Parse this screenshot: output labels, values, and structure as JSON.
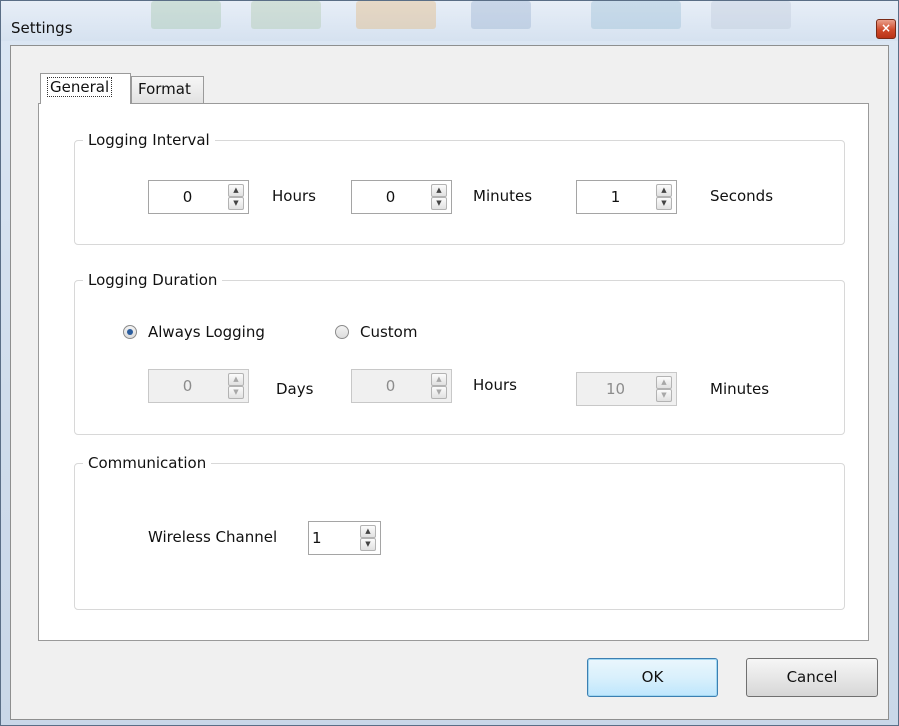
{
  "window": {
    "title": "Settings",
    "close_glyph": "×"
  },
  "tabs": [
    {
      "label": "General",
      "active": true
    },
    {
      "label": "Format",
      "active": false
    }
  ],
  "logging_interval": {
    "title": "Logging Interval",
    "hours": {
      "value": "0",
      "unit": "Hours"
    },
    "minutes": {
      "value": "0",
      "unit": "Minutes"
    },
    "seconds": {
      "value": "1",
      "unit": "Seconds"
    }
  },
  "logging_duration": {
    "title": "Logging Duration",
    "always_label": "Always Logging",
    "custom_label": "Custom",
    "selected": "always",
    "days": {
      "value": "0",
      "unit": "Days"
    },
    "hours": {
      "value": "0",
      "unit": "Hours"
    },
    "minutes": {
      "value": "10",
      "unit": "Minutes"
    }
  },
  "communication": {
    "title": "Communication",
    "channel_label": "Wireless Channel",
    "channel_value": "1"
  },
  "buttons": {
    "ok": "OK",
    "cancel": "Cancel"
  },
  "icons": {
    "up": "▲",
    "down": "▼"
  },
  "colors": {
    "accent": "#3c7fb1",
    "radio_dot": "#2b5d9e"
  }
}
